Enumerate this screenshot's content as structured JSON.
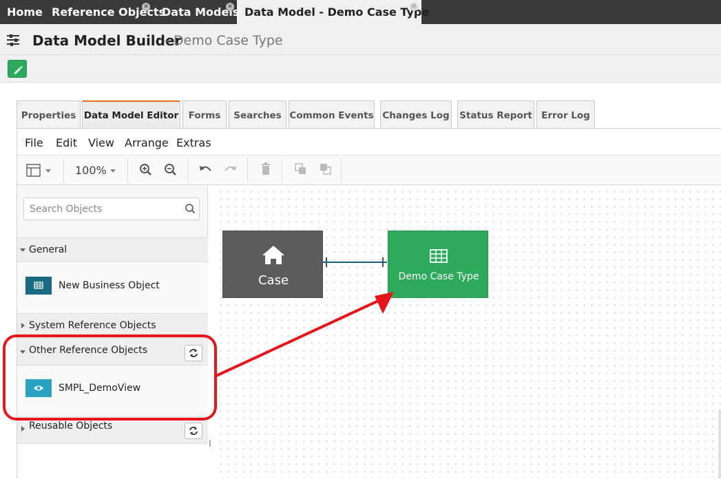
{
  "top_tabs": [
    {
      "label": "Home",
      "closable": false
    },
    {
      "label": "Reference Objects",
      "closable": true
    },
    {
      "label": "Data Models",
      "closable": true
    },
    {
      "label": "Data Model - Demo Case Type",
      "closable": true,
      "active": true
    }
  ],
  "header": {
    "title": "Data Model Builder",
    "subtitle": "- Demo Case Type"
  },
  "tabs": [
    {
      "label": "Properties"
    },
    {
      "label": "Data Model Editor",
      "active": true
    },
    {
      "label": "Forms"
    },
    {
      "label": "Searches"
    },
    {
      "label": "Common Events"
    },
    {
      "label": "Changes Log"
    },
    {
      "label": "Status Report"
    },
    {
      "label": "Error Log"
    }
  ],
  "menubar": {
    "file": "File",
    "edit": "Edit",
    "view": "View",
    "arrange": "Arrange",
    "extras": "Extras"
  },
  "toolbar": {
    "zoom": "100%"
  },
  "sidebar": {
    "search_placeholder": "Search Objects",
    "general": {
      "label": "General",
      "item": "New Business Object"
    },
    "system_ref": {
      "label": "System Reference Objects"
    },
    "other_ref": {
      "label": "Other Reference Objects",
      "item": "SMPL_DemoView"
    },
    "reusable": {
      "label": "Reusable Objects"
    }
  },
  "canvas": {
    "case_node": "Case",
    "demo_node": "Demo Case Type"
  },
  "colors": {
    "accent_green": "#2eaa5c",
    "badge_teal": "#1a6b82",
    "badge_cyan": "#2aa3c4",
    "annotation_red": "#e8141b",
    "tab_orange": "#e87022"
  }
}
